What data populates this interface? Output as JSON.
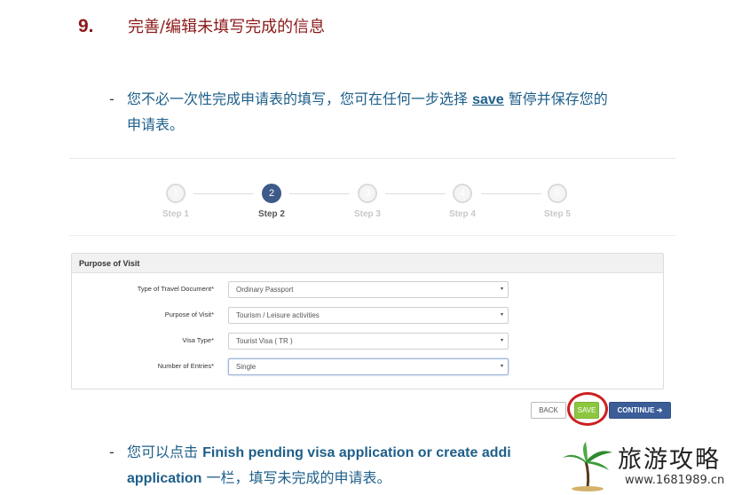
{
  "heading": {
    "number": "9.",
    "title": "完善/编辑未填写完成的信息"
  },
  "para1": {
    "dash": "-",
    "text_before": "您不必一次性完成申请表的填写，您可在任何一步选择 ",
    "keyword": "save",
    "text_after": " 暂停并保存您的",
    "line2": "申请表。"
  },
  "stepper": {
    "steps": [
      {
        "num": "1",
        "label": "Step 1"
      },
      {
        "num": "2",
        "label": "Step 2"
      },
      {
        "num": "3",
        "label": "Step 3"
      },
      {
        "num": "4",
        "label": "Step 4"
      },
      {
        "num": "5",
        "label": "Step 5"
      }
    ],
    "active_index": 1
  },
  "panel": {
    "title": "Purpose of Visit",
    "fields": [
      {
        "label": "Type of Travel Document*",
        "value": "Ordinary Passport"
      },
      {
        "label": "Purpose of Visit*",
        "value": "Tourism / Leisure activities"
      },
      {
        "label": "Visa Type*",
        "value": "Tourist Visa ( TR )"
      },
      {
        "label": "Number of Entries*",
        "value": "Single"
      }
    ]
  },
  "buttons": {
    "back": "BACK",
    "save": "SAVE",
    "continue": "CONTINUE ➔"
  },
  "para2": {
    "dash": "-",
    "text_before": "您可以点击 ",
    "keyword": "Finish pending visa application or create addi",
    "keyword_line2": "application",
    "text_after": " 一栏，填写未完成的申请表。"
  },
  "watermark": {
    "brand": "旅游攻略",
    "url": "www.1681989.cn"
  },
  "colors": {
    "heading": "#8b1a1a",
    "body_text": "#1e5f8a",
    "active_step": "#3d5a8a",
    "save_button": "#8dc63f",
    "continue_button": "#3b5d98",
    "highlight_ring": "#cc1f1f"
  }
}
